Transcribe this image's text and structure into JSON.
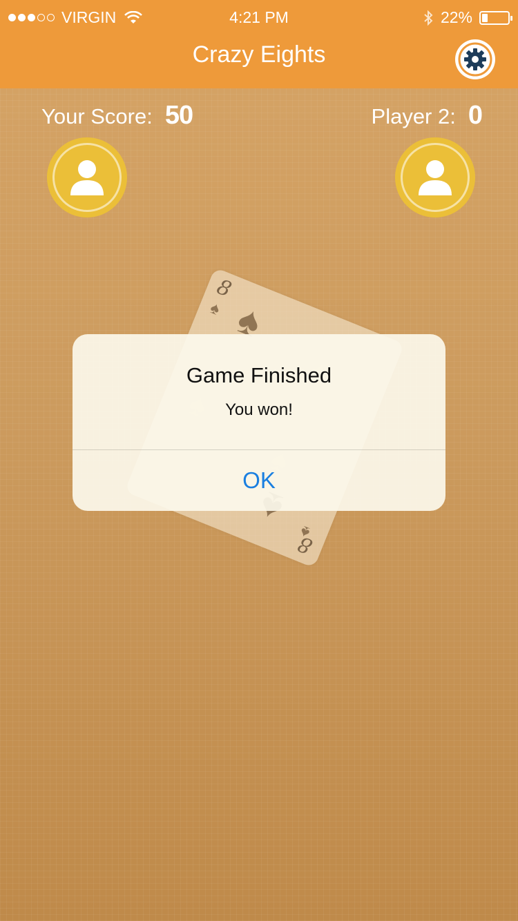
{
  "status_bar": {
    "carrier": "VIRGIN",
    "signal_bars_filled": 3,
    "signal_bars_total": 5,
    "time": "4:21 PM",
    "battery": "22%",
    "battery_level": 0.22
  },
  "header": {
    "title": "Crazy Eights",
    "settings_icon": "gear-icon",
    "color": "#ee9a3a"
  },
  "scores": {
    "your_label": "Your Score:",
    "your_value": "50",
    "player2_label": "Player 2:",
    "player2_value": "0"
  },
  "card": {
    "rank": "8",
    "suit": "spades"
  },
  "alert": {
    "title": "Game Finished",
    "message": "You won!",
    "ok_label": "OK",
    "ok_color": "#1a7fe0"
  }
}
